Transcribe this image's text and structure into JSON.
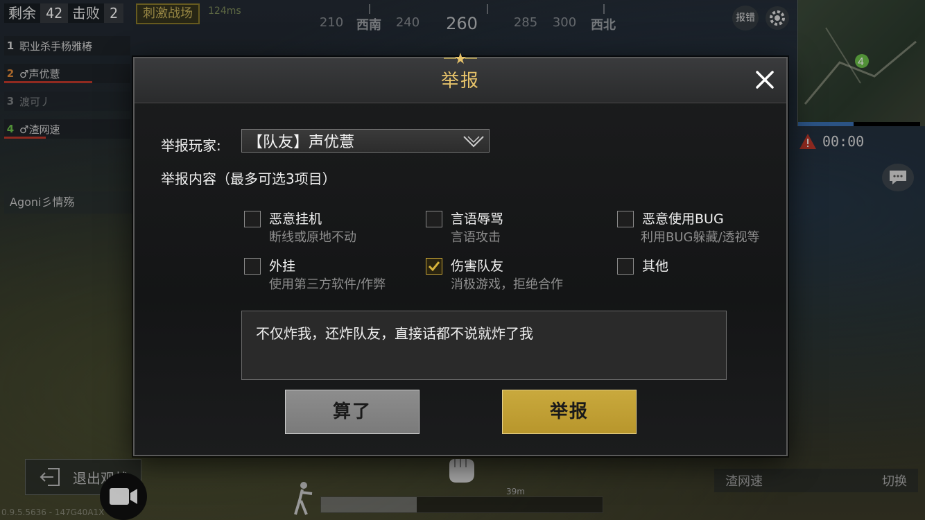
{
  "hud": {
    "remaining_label": "剩余",
    "remaining_value": "42",
    "kills_label": "击败",
    "kills_value": "2",
    "mode_badge": "刺激战场",
    "ping": "124ms",
    "team": [
      {
        "index": "1",
        "name": "职业杀手杨雅椿",
        "health": 0
      },
      {
        "index": "2",
        "name": "♂声优薏",
        "health": 0.7
      },
      {
        "index": "3",
        "name": "渡可丿",
        "health": 0
      },
      {
        "index": "4",
        "name": "♂渣网速",
        "health": 0.33
      }
    ],
    "spectating": "Agoni彡情殇",
    "compass": {
      "heading": "260",
      "marks": [
        "210",
        "西南",
        "240",
        "260",
        "285",
        "300",
        "西北"
      ]
    },
    "report_bug_label": "报错",
    "map_timer": "00:00",
    "exit_label": "退出观战",
    "version": "0.9.5.5636 - 147G40A1X",
    "distance": "39m",
    "spectate_name": "渣网速",
    "switch_label": "切换",
    "health_level": 0.34
  },
  "modal": {
    "title": "举报",
    "player_label": "举报玩家:",
    "player_value": "【队友】声优薏",
    "content_label": "举报内容（最多可选3项目）",
    "options": [
      {
        "title": "恶意挂机",
        "desc": "断线或原地不动",
        "checked": false
      },
      {
        "title": "言语辱骂",
        "desc": "言语攻击",
        "checked": false
      },
      {
        "title": "恶意使用BUG",
        "desc": "利用BUG躲藏/透视等",
        "checked": false
      },
      {
        "title": "外挂",
        "desc": "使用第三方软件/作弊",
        "checked": false
      },
      {
        "title": "伤害队友",
        "desc": "消极游戏，拒绝合作",
        "checked": true
      },
      {
        "title": "其他",
        "desc": "",
        "checked": false
      }
    ],
    "comment": "不仅炸我，还炸队友，直接话都不说就炸了我",
    "cancel_label": "算了",
    "submit_label": "举报"
  },
  "colors": {
    "accent_gold": "#e7c36a",
    "button_gold": "#c9a93d",
    "check_gold": "#d8b43a"
  }
}
